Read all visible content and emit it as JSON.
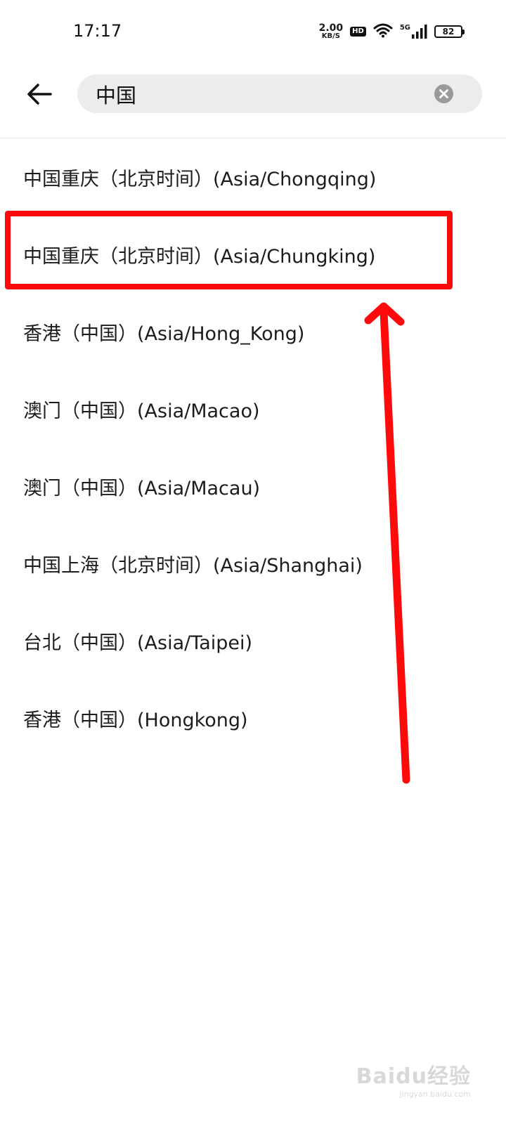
{
  "status_bar": {
    "time": "17:17",
    "net_speed_value": "2.00",
    "net_speed_unit": "KB/S",
    "hd_label": "HD",
    "signal_label": "5G",
    "battery": "82"
  },
  "search": {
    "query": "中国",
    "placeholder": ""
  },
  "timezones": [
    "中国重庆（北京时间）(Asia/Chongqing)",
    "中国重庆（北京时间）(Asia/Chungking)",
    "香港（中国）(Asia/Hong_Kong)",
    "澳门（中国）(Asia/Macao)",
    "澳门（中国）(Asia/Macau)",
    "中国上海（北京时间）(Asia/Shanghai)",
    "台北（中国）(Asia/Taipei)",
    "香港（中国）(Hongkong)"
  ],
  "annotation": {
    "highlighted_index": 1,
    "color": "#ff0a0a"
  },
  "watermark": {
    "logo": "Baidu经验",
    "url": "jingyan.baidu.com"
  },
  "colors": {
    "search_bg": "#ececec",
    "text": "#1c1c1c",
    "annotation": "#ff0a0a"
  },
  "icons": [
    "back-arrow-icon",
    "clear-icon",
    "wifi-icon",
    "signal-icon",
    "battery-icon"
  ]
}
